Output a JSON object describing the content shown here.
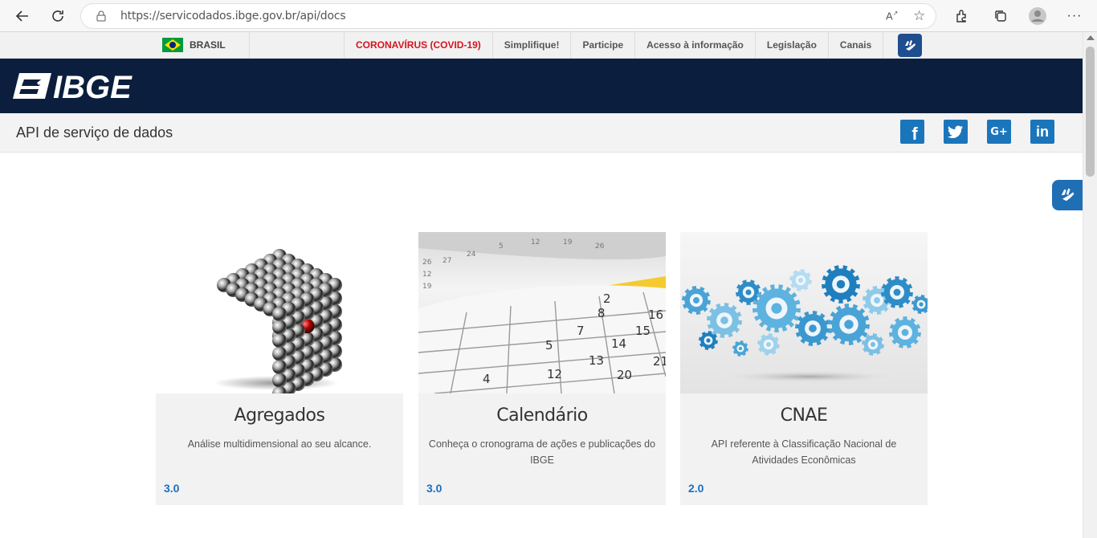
{
  "browser": {
    "url": "https://servicodados.ibge.gov.br/api/docs"
  },
  "govbar": {
    "country": "BRASIL",
    "links": [
      "CORONAVÍRUS (COVID-19)",
      "Simplifique!",
      "Participe",
      "Acesso à informação",
      "Legislação",
      "Canais"
    ]
  },
  "header": {
    "logo_text": "IBGE",
    "subtitle": "API de serviço de dados"
  },
  "social": [
    "facebook-icon",
    "twitter-icon",
    "google-plus-icon",
    "linkedin-icon"
  ],
  "cards": [
    {
      "title": "Agregados",
      "description": "Análise multidimensional ao seu alcance.",
      "version": "3.0",
      "image": "metal-spheres-cube"
    },
    {
      "title": "Calendário",
      "description": "Conheça o cronograma de ações e publicações do IBGE",
      "version": "3.0",
      "image": "calendar-pages"
    },
    {
      "title": "CNAE",
      "description": "API referente à Classificação Nacional de Atividades Econômicas",
      "version": "2.0",
      "image": "blue-gears"
    }
  ],
  "colors": {
    "header_bg": "#0b1e3d",
    "accent": "#1b75bb",
    "covid_red": "#d7141c"
  }
}
